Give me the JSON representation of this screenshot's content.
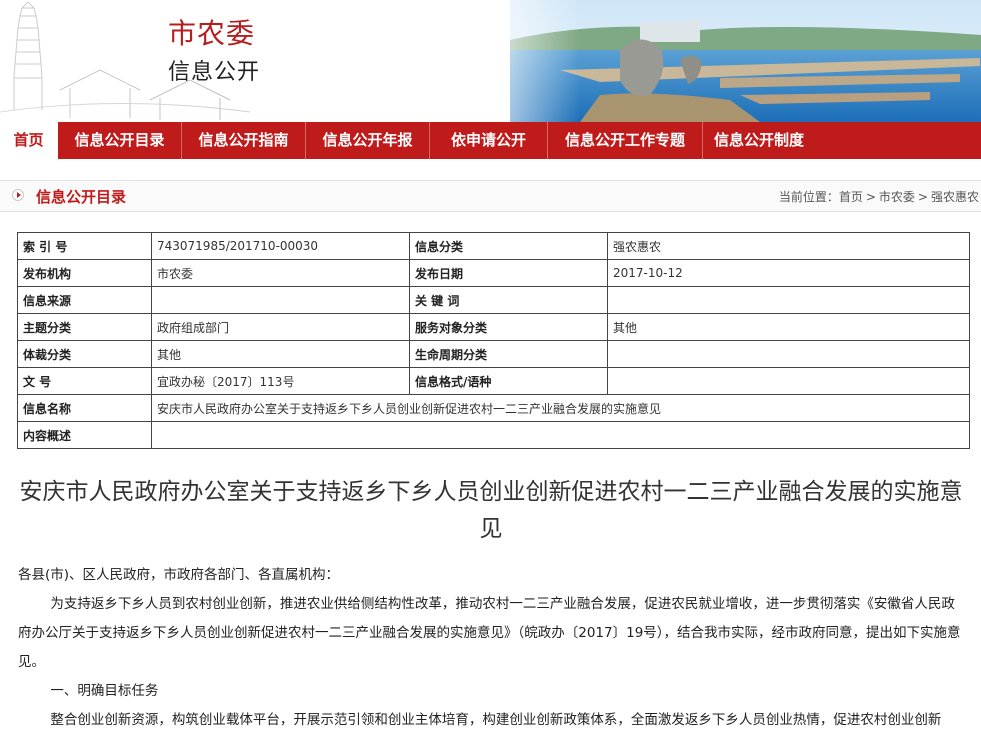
{
  "header": {
    "title": "市农委",
    "subtitle": "信息公开"
  },
  "nav": {
    "items": [
      {
        "label": "首页",
        "active": true
      },
      {
        "label": "信息公开目录"
      },
      {
        "label": "信息公开指南"
      },
      {
        "label": "信息公开年报"
      },
      {
        "label": "依申请公开"
      },
      {
        "label": "信息公开工作专题"
      },
      {
        "label": "信息公开制度"
      }
    ]
  },
  "breadcrumb_bar": {
    "section": "信息公开目录",
    "location_label": "当前位置：",
    "path": [
      "首页",
      "市农委",
      "强农惠农"
    ],
    "separator": ">"
  },
  "meta_table": {
    "rows": [
      [
        {
          "k": "索 引 号",
          "v": "743071985/201710-00030"
        },
        {
          "k": "信息分类",
          "v": "强农惠农"
        }
      ],
      [
        {
          "k": "发布机构",
          "v": "市农委"
        },
        {
          "k": "发布日期",
          "v": "2017-10-12"
        }
      ],
      [
        {
          "k": "信息来源",
          "v": ""
        },
        {
          "k": "关 键 词",
          "v": ""
        }
      ],
      [
        {
          "k": "主题分类",
          "v": "政府组成部门"
        },
        {
          "k": "服务对象分类",
          "v": "其他"
        }
      ],
      [
        {
          "k": "体裁分类",
          "v": "其他"
        },
        {
          "k": "生命周期分类",
          "v": ""
        }
      ],
      [
        {
          "k": "文 号",
          "v": "宜政办秘〔2017〕113号"
        },
        {
          "k": "信息格式/语种",
          "v": ""
        }
      ]
    ],
    "name_label": "信息名称",
    "name_value": "安庆市人民政府办公室关于支持返乡下乡人员创业创新促进农村一二三产业融合发展的实施意见",
    "summary_label": "内容概述",
    "summary_value": ""
  },
  "article": {
    "title": "安庆市人民政府办公室关于支持返乡下乡人员创业创新促进农村一二三产业融合发展的实施意见",
    "salutation": "各县(市)、区人民政府，市政府各部门、各直属机构：",
    "para1": "为支持返乡下乡人员到农村创业创新，推进农业供给侧结构性改革，推动农村一二三产业融合发展，促进农民就业增收，进一步贯彻落实《安徽省人民政府办公厅关于支持返乡下乡人员创业创新促进农村一二三产业融合发展的实施意见》（皖政办〔2017〕19号），结合我市实际，经市政府同意，提出如下实施意见。",
    "heading1": "一、明确目标任务",
    "para2": "整合创业创新资源，构筑创业载体平台，开展示范引领和创业主体培育，构建创业创新政策体系，全面激发返乡下乡人员创业热情，促进农村创业创新"
  },
  "colors": {
    "brand_red": "#c01b1b",
    "title_red": "#b41e1e"
  }
}
